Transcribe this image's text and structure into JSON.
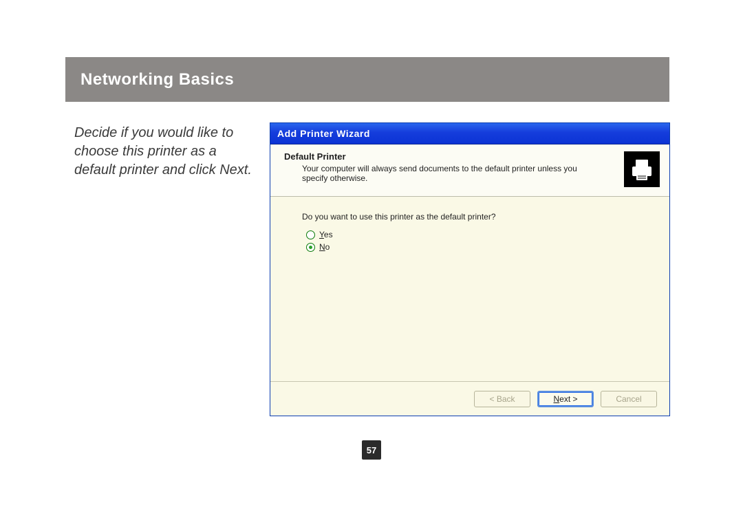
{
  "header": {
    "title": "Networking Basics"
  },
  "instruction": {
    "text": "Decide if you would like to choose this printer as a default printer and click Next."
  },
  "dialog": {
    "title": "Add Printer Wizard",
    "section_title": "Default Printer",
    "section_subtitle": "Your computer will always send documents to the default printer unless you specify otherwise.",
    "question": "Do you want to use this printer as the default printer?",
    "options": {
      "yes": {
        "label": "Yes",
        "selected": false
      },
      "no": {
        "label": "No",
        "selected": true
      }
    },
    "buttons": {
      "back": {
        "label": "< Back",
        "enabled": false
      },
      "next": {
        "label": "Next >",
        "enabled": true,
        "default": true
      },
      "cancel": {
        "label": "Cancel",
        "enabled": false
      }
    }
  },
  "page_number": "57"
}
